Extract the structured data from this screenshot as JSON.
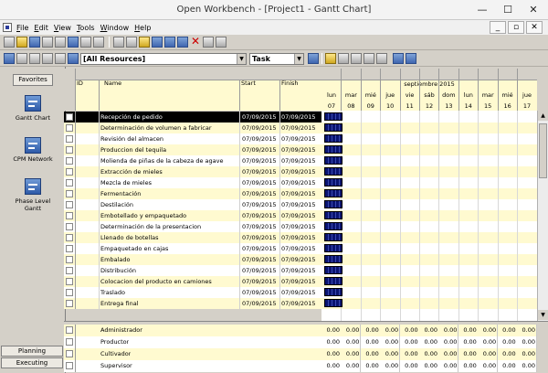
{
  "window": {
    "title": "Open Workbench - [Project1 - Gantt Chart]",
    "min": "—",
    "max": "☐",
    "close": "✕"
  },
  "menu": [
    "File",
    "Edit",
    "View",
    "Tools",
    "Window",
    "Help"
  ],
  "toolbar2": {
    "resource_filter": "[All Resources]",
    "view_mode": "Task"
  },
  "sidebar": {
    "favorites": "Favorites",
    "items": [
      {
        "label": "Gantt Chart",
        "icon": "gantt-chart-icon"
      },
      {
        "label": "CPM Network",
        "icon": "cpm-network-icon"
      },
      {
        "label": "Phase Level Gantt",
        "icon": "phase-level-gantt-icon"
      }
    ],
    "bottom_tabs": [
      "Planning",
      "Executing"
    ]
  },
  "table": {
    "columns": {
      "id": "ID",
      "name": "Name",
      "start": "Start",
      "finish": "Finish"
    },
    "rows": [
      {
        "name": "Recepción de pedido",
        "start": "07/09/2015",
        "finish": "07/09/2015"
      },
      {
        "name": "Determinación de volumen a fabricar",
        "start": "07/09/2015",
        "finish": "07/09/2015"
      },
      {
        "name": "Revisión del almacen",
        "start": "07/09/2015",
        "finish": "07/09/2015"
      },
      {
        "name": "Produccion del tequila",
        "start": "07/09/2015",
        "finish": "07/09/2015"
      },
      {
        "name": "Molienda de piñas de la cabeza de agave",
        "start": "07/09/2015",
        "finish": "07/09/2015"
      },
      {
        "name": "Extracción de mieles",
        "start": "07/09/2015",
        "finish": "07/09/2015"
      },
      {
        "name": "Mezcla de mieles",
        "start": "07/09/2015",
        "finish": "07/09/2015"
      },
      {
        "name": "Fermentación",
        "start": "07/09/2015",
        "finish": "07/09/2015"
      },
      {
        "name": "Destilación",
        "start": "07/09/2015",
        "finish": "07/09/2015"
      },
      {
        "name": "Embotellado y empaquetado",
        "start": "07/09/2015",
        "finish": "07/09/2015"
      },
      {
        "name": "Determinación de la presentacion",
        "start": "07/09/2015",
        "finish": "07/09/2015"
      },
      {
        "name": "Llenado de botellas",
        "start": "07/09/2015",
        "finish": "07/09/2015"
      },
      {
        "name": "Empaquetado en cajas",
        "start": "07/09/2015",
        "finish": "07/09/2015"
      },
      {
        "name": "Embalado",
        "start": "07/09/2015",
        "finish": "07/09/2015"
      },
      {
        "name": "Distribución",
        "start": "07/09/2015",
        "finish": "07/09/2015"
      },
      {
        "name": "Colocacion del producto en camiones",
        "start": "07/09/2015",
        "finish": "07/09/2015"
      },
      {
        "name": "Traslado",
        "start": "07/09/2015",
        "finish": "07/09/2015"
      },
      {
        "name": "Entrega final",
        "start": "07/09/2015",
        "finish": "07/09/2015"
      }
    ]
  },
  "gantt": {
    "month": "septiembre 2015",
    "days": [
      {
        "dow": "lun",
        "num": "07"
      },
      {
        "dow": "mar",
        "num": "08"
      },
      {
        "dow": "mié",
        "num": "09"
      },
      {
        "dow": "jue",
        "num": "10"
      },
      {
        "dow": "vie",
        "num": "11"
      },
      {
        "dow": "sáb",
        "num": "12"
      },
      {
        "dow": "dom",
        "num": "13"
      },
      {
        "dow": "lun",
        "num": "14"
      },
      {
        "dow": "mar",
        "num": "15"
      },
      {
        "dow": "mié",
        "num": "16"
      },
      {
        "dow": "jue",
        "num": "17"
      }
    ]
  },
  "resources": [
    {
      "name": "Administrador",
      "values": [
        "0.00",
        "0.00",
        "0.00",
        "0.00",
        "0.00",
        "0.00",
        "0.00",
        "0.00",
        "0.00",
        "0.00",
        "0.00"
      ]
    },
    {
      "name": "Productor",
      "values": [
        "0.00",
        "0.00",
        "0.00",
        "0.00",
        "0.00",
        "0.00",
        "0.00",
        "0.00",
        "0.00",
        "0.00",
        "0.00"
      ]
    },
    {
      "name": "Cultivador",
      "values": [
        "0.00",
        "0.00",
        "0.00",
        "0.00",
        "0.00",
        "0.00",
        "0.00",
        "0.00",
        "0.00",
        "0.00",
        "0.00"
      ]
    },
    {
      "name": "Supervisor",
      "values": [
        "0.00",
        "0.00",
        "0.00",
        "0.00",
        "0.00",
        "0.00",
        "0.00",
        "0.00",
        "0.00",
        "0.00",
        "0.00"
      ]
    }
  ]
}
